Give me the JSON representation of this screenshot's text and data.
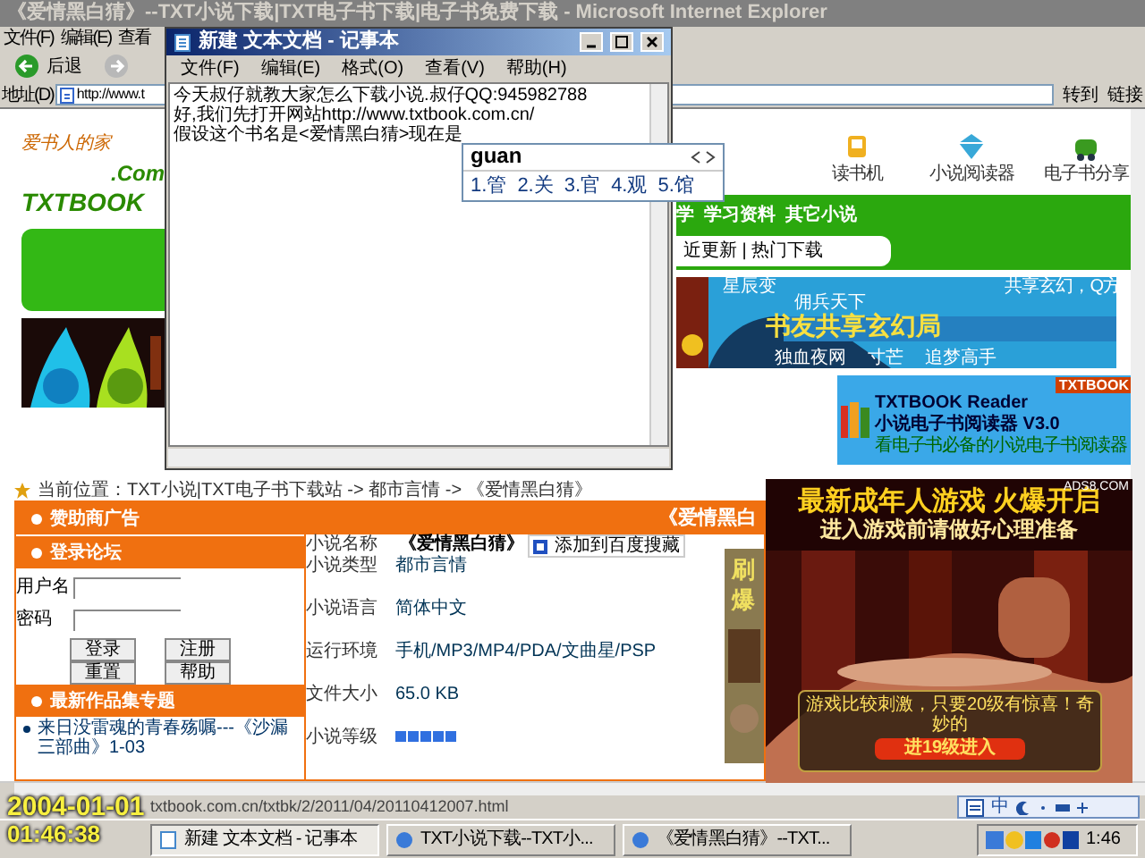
{
  "ie_window": {
    "title": "《爱情黑白猜》--TXT小说下载|TXT电子书下载|电子书免费下载 - Microsoft Internet Explorer",
    "menu": [
      "文件(F)",
      "编辑(E)",
      "查看"
    ],
    "back": "后退",
    "address_label": "地址(D)",
    "address_value": "http://www.t",
    "go": "转到",
    "links": "链接"
  },
  "page": {
    "logo": {
      "tagline": "爱书人的家",
      "domain": ".Com",
      "name": "TXTBOOK"
    },
    "site_tools": [
      "读书机",
      "小说阅读器",
      "电子书分享"
    ],
    "nav": "学  学习资料  其它小说",
    "sub_nav": "近更新 | 热门下载",
    "banner": {
      "tag": "星辰变",
      "title": "书友共享玄幻局",
      "lines": [
        "佣兵天下",
        "共享玄幻，Q方",
        "独血夜网",
        "寸芒",
        "追梦高手"
      ]
    },
    "reader_ad": {
      "badge": "TXTBOOK",
      "title": "TXTBOOK Reader",
      "subtitle": "小说电子书阅读器 V3.0",
      "note": "看电子书必备的小说电子书阅读器"
    },
    "breadcrumb": "当前位置：TXT小说|TXT电子书下载站 -> 都市言情 -> 《爱情黑白猜》",
    "sections": [
      "赞助商广告",
      "登录论坛",
      "最新作品集专题"
    ],
    "login": {
      "user_label": "用户名",
      "password_label": "密码",
      "buttons": [
        "登录",
        "注册",
        "重置",
        "帮助"
      ]
    },
    "latest": "来日没雷魂的青春殇嘱---《沙漏三部曲》1-03",
    "book_header": "《爱情黑白",
    "details": [
      {
        "label": "小说名称",
        "value": "《爱情黑白猜》",
        "kind": "title"
      },
      {
        "label": "小说类型",
        "value": "都市言情",
        "kind": "text"
      },
      {
        "label": "小说语言",
        "value": "简体中文",
        "kind": "text"
      },
      {
        "label": "运行环境",
        "value": "手机/MP3/MP4/PDA/文曲星/PSP",
        "kind": "text"
      },
      {
        "label": "文件大小",
        "value": "65.0 KB",
        "kind": "text"
      },
      {
        "label": "小说等级",
        "kind": "rating",
        "stars": 5
      }
    ],
    "bookmark": "添加到百度搜藏",
    "side_ad": "刷爆"
  },
  "status_bar": {
    "url": "txtbook.com.cn/txtbk/2/2011/04/20110412007.html"
  },
  "ime_bar": {
    "mode": "中"
  },
  "game_ad": {
    "headline": "最新成年人游戏 火爆开启",
    "subline": "进入游戏前请做好心理准备",
    "notice": "游戏比较刺激，只要20级有惊喜！奇妙的",
    "button": "进19级进入",
    "source": "ADS8.COM"
  },
  "notepad": {
    "title": "新建 文本文档 - 记事本",
    "menu": [
      "文件(F)",
      "编辑(E)",
      "格式(O)",
      "查看(V)",
      "帮助(H)"
    ],
    "lines": [
      "今天叔仔就教大家怎么下载小说.叔仔QQ:945982788",
      "好,我们先打开网站http://www.txtbook.com.cn/",
      "假设这个书名是<爱情黑白猜>现在是"
    ]
  },
  "ime_popup": {
    "input": "guan",
    "candidates": [
      "1.管",
      "2.关",
      "3.官",
      "4.观",
      "5.馆"
    ]
  },
  "taskbar": {
    "tasks": [
      {
        "label": "新建 文本文档 - 记事本",
        "selected": true
      },
      {
        "label": "TXT小说下载--TXT小...",
        "selected": false
      },
      {
        "label": "《爱情黑白猜》--TXT...",
        "selected": false
      }
    ],
    "clock": "1:46"
  },
  "overlay": {
    "date": "2004-01-01",
    "time": "01:46:38"
  }
}
